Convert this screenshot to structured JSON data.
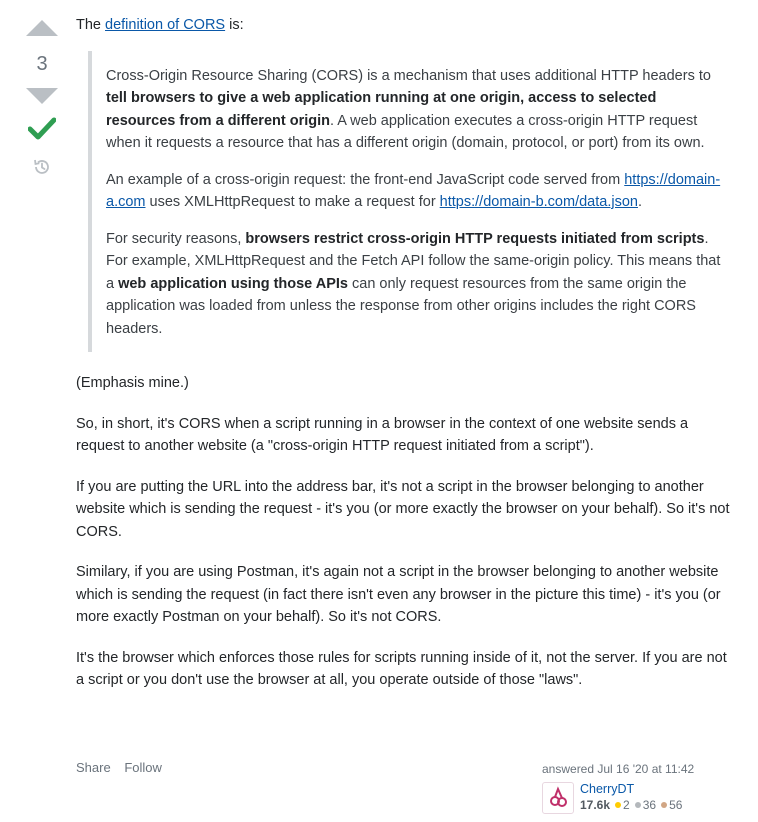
{
  "vote": {
    "count": "3"
  },
  "post": {
    "intro": {
      "before": "The ",
      "link": "definition of CORS",
      "after": " is:"
    },
    "quote": {
      "p1": {
        "a": "Cross-Origin Resource Sharing (CORS) is a mechanism that uses additional HTTP headers to ",
        "b": "tell browsers to give a web application running at one origin, access to selected resources from a different origin",
        "c": ". A web application executes a cross-origin HTTP request when it requests a resource that has a different origin (domain, protocol, or port) from its own."
      },
      "p2": {
        "a": "An example of a cross-origin request: the front-end JavaScript code served from ",
        "link1": "https://domain-a.com",
        "b": " uses XMLHttpRequest to make a request for ",
        "link2": "https://domain-b.com/data.json",
        "c": "."
      },
      "p3": {
        "a": "For security reasons, ",
        "b": "browsers restrict cross-origin HTTP requests initiated from scripts",
        "c": ". For example, XMLHttpRequest and the Fetch API follow the same-origin policy. This means that a ",
        "d": "web application using those APIs",
        "e": " can only request resources from the same origin the application was loaded from unless the response from other origins includes the right CORS headers."
      }
    },
    "emphasis": "(Emphasis mine.)",
    "para1": "So, in short, it's CORS when a script running in a browser in the context of one website sends a request to another website (a \"cross-origin HTTP request initiated from a script\").",
    "para2": "If you are putting the URL into the address bar, it's not a script in the browser belonging to another website which is sending the request - it's you (or more exactly the browser on your behalf). So it's not CORS.",
    "para3": "Similary, if you are using Postman, it's again not a script in the browser belonging to another website which is sending the request (in fact there isn't even any browser in the picture this time) - it's you (or more exactly Postman on your behalf). So it's not CORS.",
    "para4": "It's the browser which enforces those rules for scripts running inside of it, not the server. If you are not a script or you don't use the browser at all, you operate outside of those \"laws\"."
  },
  "menu": {
    "share": "Share",
    "follow": "Follow"
  },
  "user": {
    "answered": "answered Jul 16 '20 at 11:42",
    "name": "CherryDT",
    "reputation": "17.6k",
    "gold": "2",
    "silver": "36",
    "bronze": "56"
  },
  "colors": {
    "link": "#0a58a8",
    "accepted": "#2f9e52",
    "arrow": "#babfc4",
    "quote_border": "#d6d9dc"
  }
}
